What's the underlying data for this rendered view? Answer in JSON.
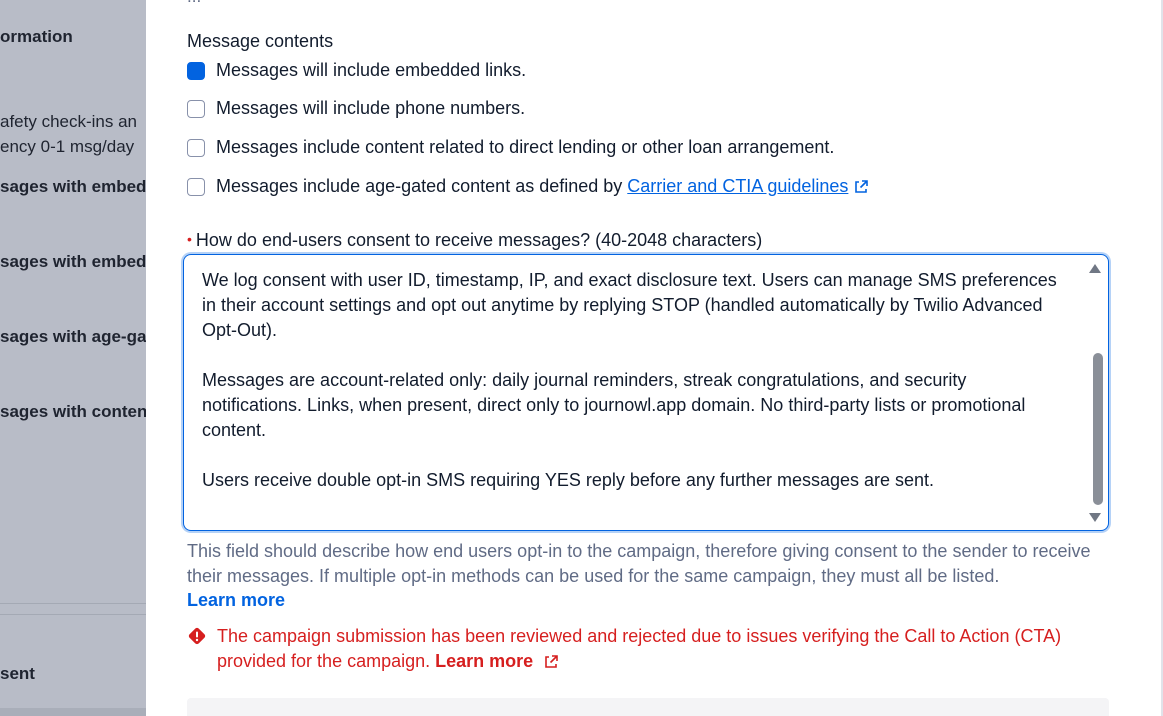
{
  "background": {
    "items": [
      {
        "text": "ormation",
        "bold": true
      },
      {
        "text": "afety check-ins an",
        "bold": false
      },
      {
        "text": "ency 0-1 msg/day",
        "bold": false
      },
      {
        "text": "sages with embed",
        "bold": true
      },
      {
        "text": "sages with embed",
        "bold": true
      },
      {
        "text": "sages with age-ga",
        "bold": true
      },
      {
        "text": "sages with conten",
        "bold": true
      },
      {
        "text": "sent",
        "bold": true
      }
    ]
  },
  "modal": {
    "cut_text": "...",
    "section_label": "Message contents",
    "checkboxes": [
      {
        "label": "Messages will include embedded links.",
        "checked": true
      },
      {
        "label": "Messages will include phone numbers.",
        "checked": false
      },
      {
        "label": "Messages include content related to direct lending or other loan arrangement.",
        "checked": false
      },
      {
        "label": "Messages include age-gated content as defined by ",
        "checked": false,
        "link": "Carrier and CTIA guidelines"
      }
    ],
    "consent_field": {
      "label": "How do end-users consent to receive messages? (40-2048 characters)",
      "value": "We log consent with user ID, timestamp, IP, and exact disclosure text. Users can manage SMS preferences in their account settings and opt out anytime by replying STOP (handled automatically by Twilio Advanced Opt-Out).\n\nMessages are account-related only: daily journal reminders, streak congratulations, and security notifications. Links, when present, direct only to journowl.app domain. No third-party lists or promotional content.\n\nUsers receive double opt-in SMS requiring YES reply before any further messages are sent.",
      "scroll_position": 0.65
    },
    "help_text": "This field should describe how end users opt-in to the campaign, therefore giving consent to the sender to receive their messages. If multiple opt-in methods can be used for the same campaign, they must all be listed.",
    "help_link": "Learn more",
    "error": {
      "text": "The campaign submission has been reviewed and rejected due to issues verifying the Call to Action (CTA) provided for the campaign. ",
      "link": "Learn more"
    }
  },
  "colors": {
    "link": "#0263e0",
    "error": "#d61f1f",
    "text": "#121c2d",
    "muted": "#606b85"
  }
}
